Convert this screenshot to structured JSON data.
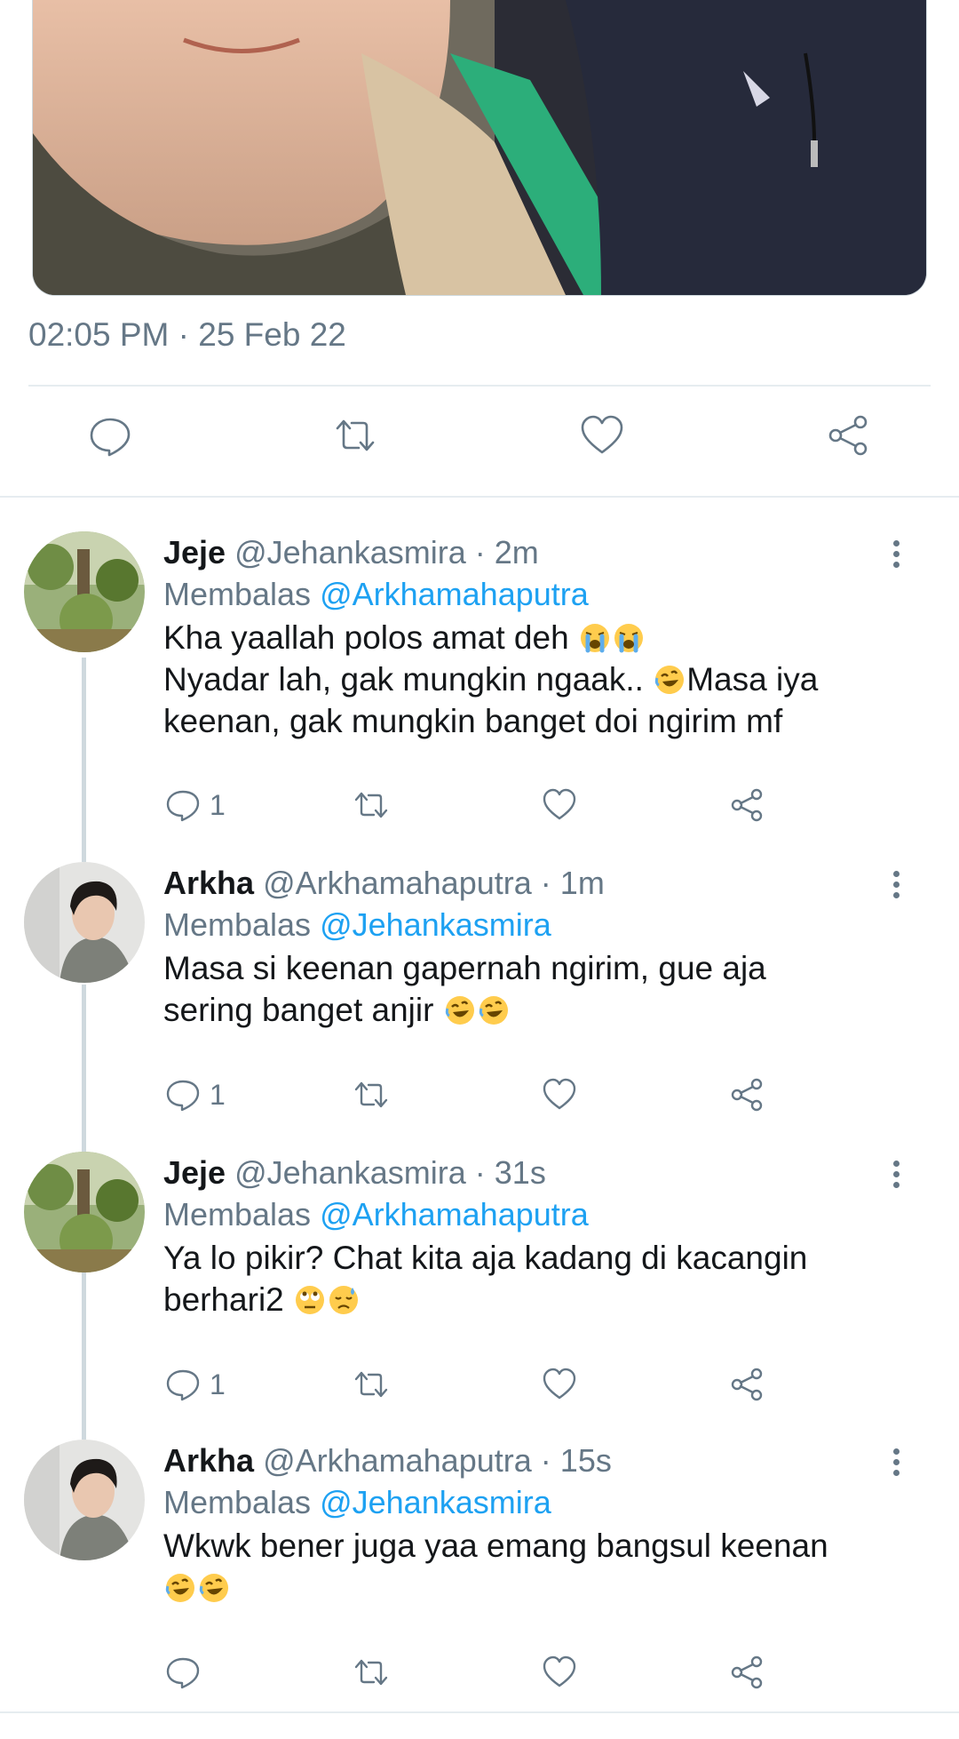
{
  "tweet": {
    "timestamp": "02:05 PM · 25 Feb 22"
  },
  "icons": {
    "reply": "reply-icon",
    "retweet": "retweet-icon",
    "like": "heart-icon",
    "share": "share-icon",
    "more": "more-vertical-icon"
  },
  "replies": [
    {
      "name": "Jeje",
      "handle": "@Jehankasmira",
      "time": "2m",
      "replying_label": "Membalas",
      "replying_to": "@Arkhamahaputra",
      "lines": [
        "Kha yaallah polos amat deh",
        "Nyadar lah, gak mungkin ngaak..",
        "Masa iya",
        "keenan, gak mungkin banget doi ngirim mf"
      ],
      "reply_count": "1"
    },
    {
      "name": "Arkha",
      "handle": "@Arkhamahaputra",
      "time": "1m",
      "replying_label": "Membalas",
      "replying_to": "@Jehankasmira",
      "lines": [
        "Masa si keenan gapernah ngirim, gue aja",
        "sering banget anjir"
      ],
      "reply_count": "1"
    },
    {
      "name": "Jeje",
      "handle": "@Jehankasmira",
      "time": "31s",
      "replying_label": "Membalas",
      "replying_to": "@Arkhamahaputra",
      "lines": [
        "Ya lo pikir? Chat kita aja kadang di kacangin",
        "berhari2"
      ],
      "reply_count": "1"
    },
    {
      "name": "Arkha",
      "handle": "@Arkhamahaputra",
      "time": "15s",
      "replying_label": "Membalas",
      "replying_to": "@Jehankasmira",
      "lines": [
        "Wkwk bener juga yaa emang bangsul keenan"
      ],
      "reply_count": ""
    }
  ],
  "colors": {
    "accent": "#1da1f2",
    "secondary_text": "#657786",
    "divider": "#e6ecf0"
  }
}
